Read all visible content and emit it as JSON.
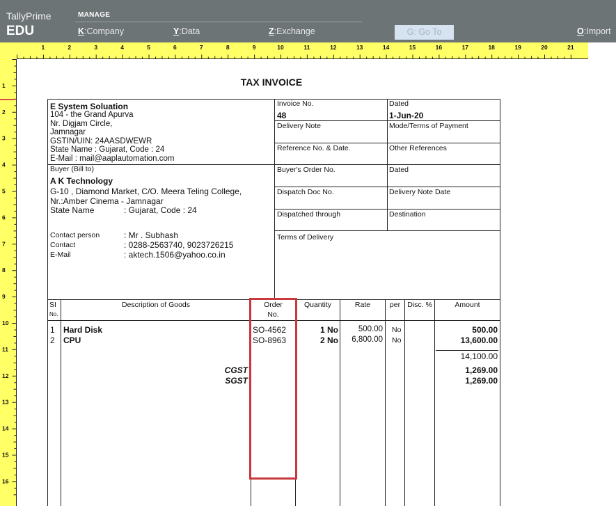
{
  "app": {
    "name": "TallyPrime",
    "edition": "EDU"
  },
  "menu": {
    "section_label": "MANAGE",
    "company": {
      "key": "K",
      "label": "Company"
    },
    "data": {
      "key": "Y",
      "label": "Data"
    },
    "exchange": {
      "key": "Z",
      "label": "Exchange"
    },
    "goto": {
      "key": "G",
      "label": "Go To"
    },
    "import": {
      "key": "O",
      "label": "Import"
    }
  },
  "ruler": {
    "top": [
      "1",
      "2",
      "3",
      "4",
      "5",
      "6",
      "7",
      "8",
      "9",
      "10",
      "11",
      "12",
      "13",
      "14",
      "15",
      "16",
      "17",
      "18",
      "19",
      "20",
      "21"
    ],
    "left": [
      "1",
      "2",
      "3",
      "4",
      "5",
      "6",
      "7",
      "8",
      "9",
      "10",
      "11",
      "12",
      "13",
      "14",
      "15",
      "16"
    ]
  },
  "invoice": {
    "title": "TAX INVOICE",
    "seller": {
      "name": "E System Soluation",
      "lines": [
        "104 - the Grand Apurva",
        "Nr. Digjam Circle,",
        "Jamnagar",
        "GSTIN/UIN: 24AASDWEWR",
        "State Name :  Gujarat, Code : 24",
        "E-Mail : mail@aaplautomation.com"
      ]
    },
    "buyer": {
      "heading": "Buyer (Bill to)",
      "name": "A K Technology",
      "lines": [
        "G-10 , Diamond Market, C/O. Meera Teling College,",
        "Nr.:Amber Cinema - Jamnagar"
      ],
      "state_label": "State Name",
      "state_value": ":  Gujarat, Code : 24",
      "contact_person_label": "Contact person",
      "contact_person_value": ":   Mr . Subhash",
      "contact_label": "Contact",
      "contact_value": ":   0288-2563740, 9023726215",
      "email_label": "E-Mail",
      "email_value": ":   aktech.1506@yahoo.co.in"
    },
    "meta": {
      "invoice_no_label": "Invoice No.",
      "invoice_no": "48",
      "dated_label": "Dated",
      "dated": "1-Jun-20",
      "delivery_note_label": "Delivery Note",
      "mode_terms_label": "Mode/Terms of Payment",
      "reference_label": "Reference No. & Date.",
      "other_refs_label": "Other References",
      "buyers_order_label": "Buyer's Order No.",
      "dated2_label": "Dated",
      "dispatch_doc_label": "Dispatch Doc No.",
      "delivery_note_date_label": "Delivery Note Date",
      "dispatched_through_label": "Dispatched through",
      "destination_label": "Destination",
      "terms_delivery_label": "Terms of Delivery"
    },
    "columns": {
      "sl_top": "SI",
      "sl_bottom": "No.",
      "description": "Description of Goods",
      "order_top": "Order",
      "order_bottom": "No.",
      "quantity": "Quantity",
      "rate": "Rate",
      "per": "per",
      "disc": "Disc. %",
      "amount": "Amount"
    },
    "items": [
      {
        "sl": "1",
        "description": "Hard Disk",
        "order": "SO-4562",
        "quantity": "1 No",
        "rate": "500.00",
        "per": "No",
        "amount": "500.00"
      },
      {
        "sl": "2",
        "description": "CPU",
        "order": "SO-8963",
        "quantity": "2 No",
        "rate": "6,800.00",
        "per": "No",
        "amount": "13,600.00"
      }
    ],
    "subtotal": "14,100.00",
    "taxes": [
      {
        "label": "CGST",
        "amount": "1,269.00"
      },
      {
        "label": "SGST",
        "amount": "1,269.00"
      }
    ]
  }
}
